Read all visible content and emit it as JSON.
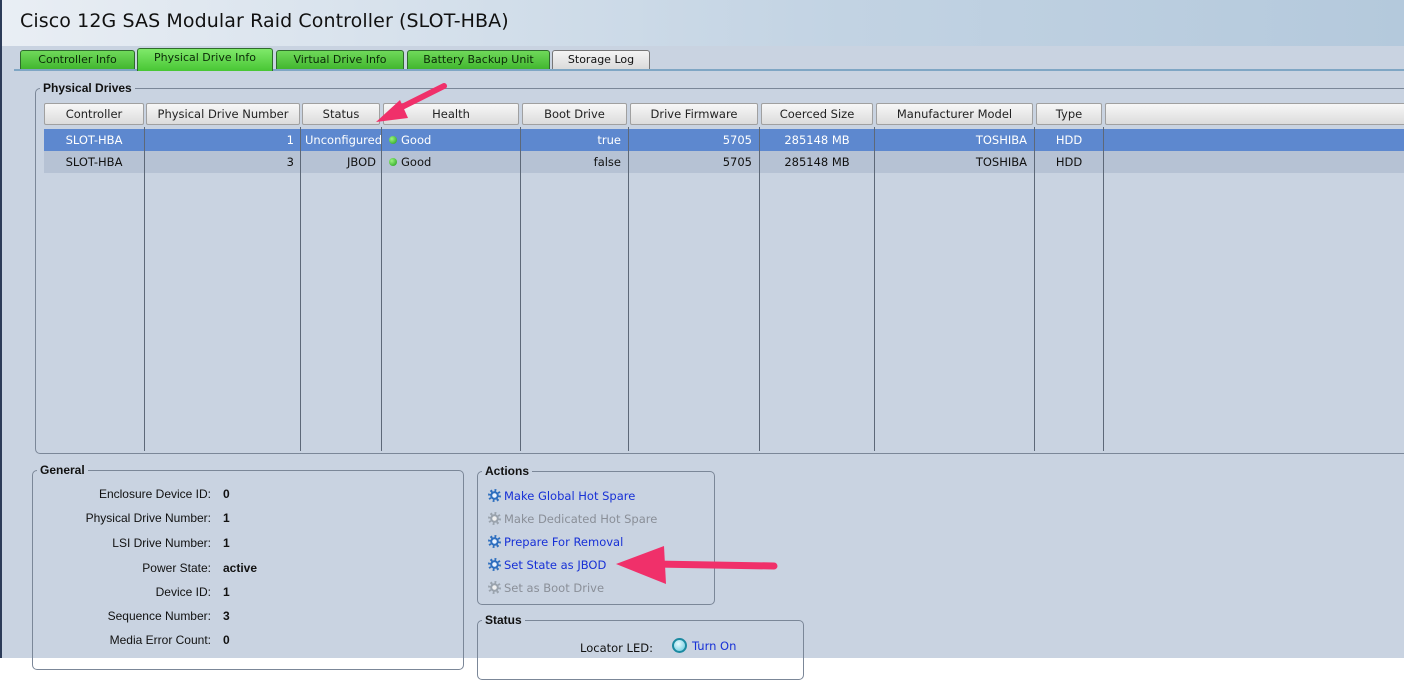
{
  "window": {
    "title": "Cisco 12G SAS Modular Raid Controller (SLOT-HBA)"
  },
  "tabs": [
    {
      "label": "Controller Info"
    },
    {
      "label": "Physical Drive Info"
    },
    {
      "label": "Virtual Drive Info"
    },
    {
      "label": "Battery Backup Unit"
    },
    {
      "label": "Storage Log"
    }
  ],
  "physical_drives": {
    "legend": "Physical Drives",
    "columns": [
      "Controller",
      "Physical Drive Number",
      "Status",
      "Health",
      "Boot Drive",
      "Drive Firmware",
      "Coerced Size",
      "Manufacturer Model",
      "Type"
    ],
    "rows": [
      [
        "SLOT-HBA",
        "1",
        "Unconfigured",
        "Good",
        "true",
        "5705",
        "285148 MB",
        "TOSHIBA",
        "HDD"
      ],
      [
        "SLOT-HBA",
        "3",
        "JBOD",
        "Good",
        "false",
        "5705",
        "285148 MB",
        "TOSHIBA",
        "HDD"
      ]
    ],
    "selected_row": 0
  },
  "general": {
    "legend": "General",
    "fields": [
      {
        "label": "Enclosure Device ID:",
        "value": "0"
      },
      {
        "label": "Physical Drive Number:",
        "value": "1"
      },
      {
        "label": "LSI Drive Number:",
        "value": "1"
      },
      {
        "label": "Power State:",
        "value": "active"
      },
      {
        "label": "Device ID:",
        "value": "1"
      },
      {
        "label": "Sequence Number:",
        "value": "3"
      },
      {
        "label": "Media Error Count:",
        "value": "0"
      }
    ]
  },
  "actions": {
    "legend": "Actions",
    "items": [
      {
        "label": "Make Global Hot Spare",
        "enabled": true
      },
      {
        "label": "Make Dedicated Hot Spare",
        "enabled": false
      },
      {
        "label": "Prepare For Removal",
        "enabled": true
      },
      {
        "label": "Set State as JBOD",
        "enabled": true
      },
      {
        "label": "Set as Boot Drive",
        "enabled": false
      }
    ]
  },
  "status": {
    "legend": "Status",
    "locator_led_label": "Locator LED:",
    "locator_led_action": "Turn On"
  },
  "colors": {
    "background": "#c9d3e1",
    "selected_row": "#5d88cf",
    "tab_green": "#48c634",
    "link_blue": "#1730d6",
    "annotation_arrow": "#f0306a"
  }
}
